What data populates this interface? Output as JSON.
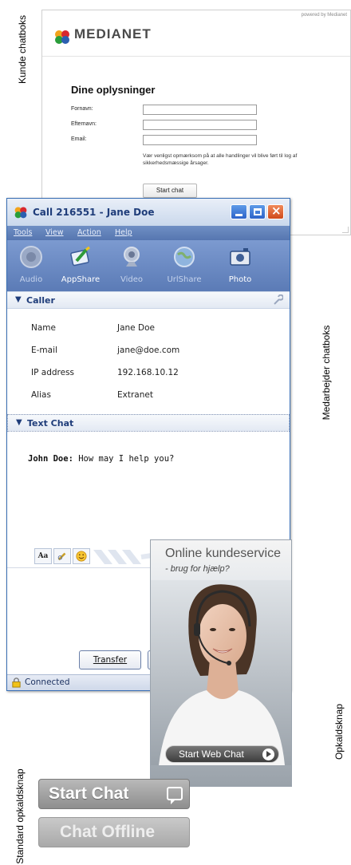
{
  "labels": {
    "customer_chat": "Kunde chatboks",
    "agent_chat": "Medarbejder chatboks",
    "popup": "Opkaldsknap",
    "standard": "Standard opkaldsknap"
  },
  "webform": {
    "powered_by": "powered by Medianet",
    "logo_text": "MEDIANET",
    "heading": "Dine oplysninger",
    "fields": [
      {
        "label": "Fornavn:",
        "value": ""
      },
      {
        "label": "Efternavn:",
        "value": ""
      },
      {
        "label": "Email:",
        "value": ""
      }
    ],
    "note": "Vær venligst opmærksom på at alle handlinger vil blive ført til log af sikkerhedsmæssige årsager.",
    "start_button": "Start chat"
  },
  "agent": {
    "title": "Call 216551 - Jane Doe",
    "menu": [
      "Tools",
      "View",
      "Action",
      "Help"
    ],
    "tools": [
      {
        "label": "Audio",
        "icon": "speaker-icon",
        "active": false
      },
      {
        "label": "AppShare",
        "icon": "appshare-icon",
        "active": true
      },
      {
        "label": "Video",
        "icon": "webcam-icon",
        "active": false
      },
      {
        "label": "UrlShare",
        "icon": "globe-icon",
        "active": false
      },
      {
        "label": "Photo",
        "icon": "camera-icon",
        "active": true
      }
    ],
    "caller_section": "Caller",
    "caller": [
      {
        "label": "Name",
        "value": "Jane Doe"
      },
      {
        "label": "E-mail",
        "value": "jane@doe.com"
      },
      {
        "label": "IP address",
        "value": "192.168.10.12"
      },
      {
        "label": "Alias",
        "value": "Extranet"
      }
    ],
    "textchat_section": "Text Chat",
    "chat_author": "John Doe:",
    "chat_message": "How may I help you?",
    "font_button": "Aa",
    "transfer_button": "Transfer",
    "status": "Connected"
  },
  "popup": {
    "title": "Online kundeservice",
    "subtitle": "- brug for hjælp?",
    "button": "Start Web Chat"
  },
  "standard_buttons": {
    "start": "Start Chat",
    "offline": "Chat Offline"
  },
  "colors": {
    "window_blue": "#5676b0",
    "title_blue": "#1f3d7a",
    "button_gray": "#9a9a9a"
  }
}
